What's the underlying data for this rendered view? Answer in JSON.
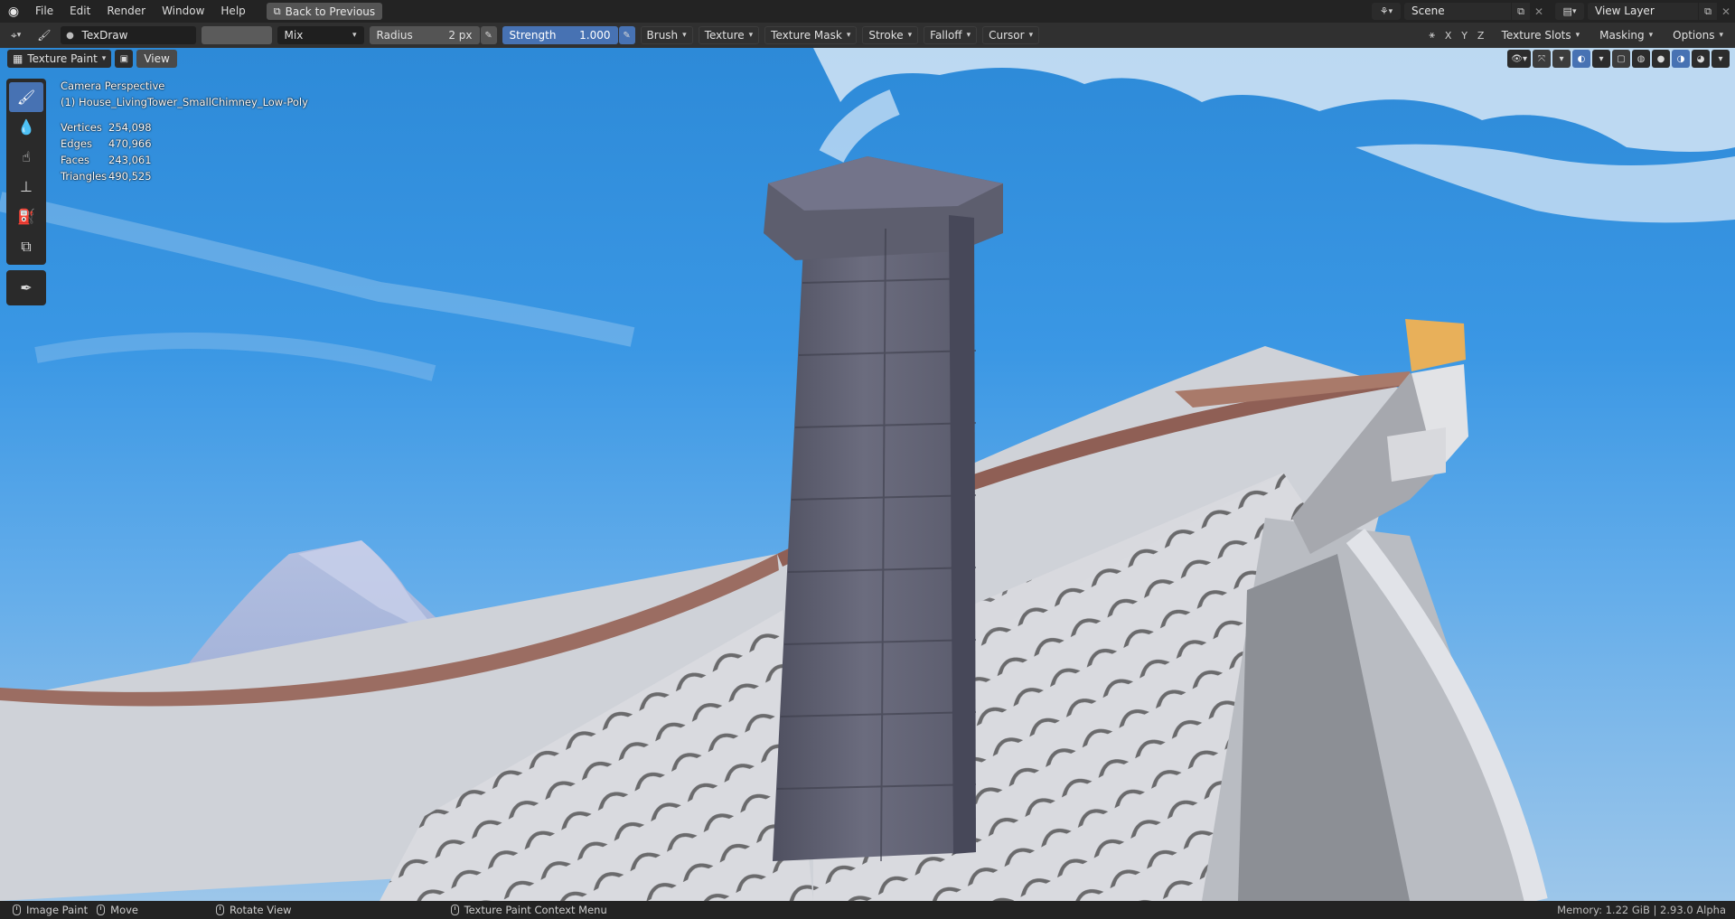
{
  "topbar": {
    "menus": [
      "File",
      "Edit",
      "Render",
      "Window",
      "Help"
    ],
    "back_label": "Back to Previous",
    "scene_label": "Scene",
    "view_layer_label": "View Layer"
  },
  "toolbar": {
    "brush_name": "TexDraw",
    "blend_mode": "Mix",
    "radius_label": "Radius",
    "radius_value": "2 px",
    "strength_label": "Strength",
    "strength_value": "1.000",
    "dropdowns": [
      "Brush",
      "Texture",
      "Texture Mask",
      "Stroke",
      "Falloff",
      "Cursor"
    ],
    "axes": [
      "X",
      "Y",
      "Z"
    ],
    "right_dropdowns": [
      "Texture Slots",
      "Masking",
      "Options"
    ]
  },
  "viewport": {
    "mode_label": "Texture Paint",
    "view_label": "View",
    "camera_label": "Camera Perspective",
    "object_label": "(1) House_LivingTower_SmallChimney_Low-Poly",
    "stats": [
      {
        "key": "Vertices",
        "value": "254,098"
      },
      {
        "key": "Edges",
        "value": "470,966"
      },
      {
        "key": "Faces",
        "value": "243,061"
      },
      {
        "key": "Triangles",
        "value": "490,525"
      }
    ]
  },
  "statusbar": {
    "image_paint": "Image Paint",
    "move": "Move",
    "rotate_view": "Rotate View",
    "context_menu": "Texture Paint Context Menu",
    "memory": "Memory: 1.22 GiB | 2.93.0 Alpha"
  },
  "colors": {
    "accent": "#4772b3",
    "header_bg": "#303030",
    "topbar_bg": "#232323",
    "sky": "#3a97e4"
  }
}
